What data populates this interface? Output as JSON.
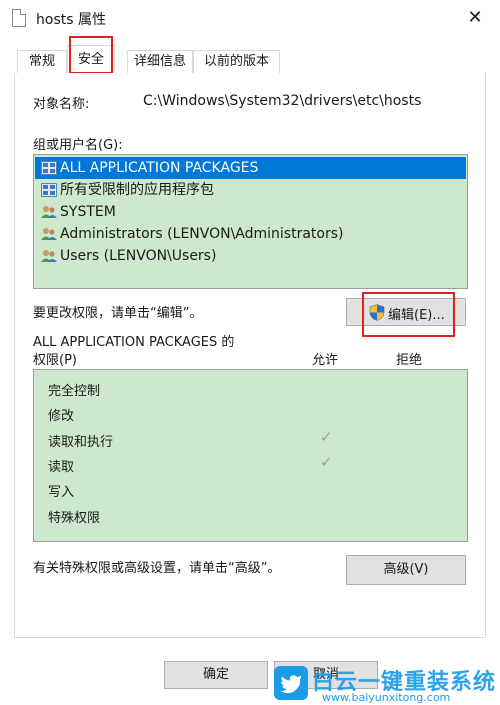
{
  "window": {
    "title": "hosts 属性",
    "close_glyph": "✕"
  },
  "tabs": [
    {
      "label": "常规"
    },
    {
      "label": "安全"
    },
    {
      "label": "详细信息"
    },
    {
      "label": "以前的版本"
    }
  ],
  "object_name": {
    "label": "对象名称:",
    "value": "C:\\Windows\\System32\\drivers\\etc\\hosts"
  },
  "groups": {
    "label": "组或用户名(G):",
    "items": [
      {
        "name": "ALL APPLICATION PACKAGES",
        "icon": "app-package-icon",
        "selected": true
      },
      {
        "name": "所有受限制的应用程序包",
        "icon": "app-package-icon",
        "selected": false
      },
      {
        "name": "SYSTEM",
        "icon": "user-group-icon",
        "selected": false
      },
      {
        "name": "Administrators (LENVON\\Administrators)",
        "icon": "user-group-icon",
        "selected": false
      },
      {
        "name": "Users (LENVON\\Users)",
        "icon": "user-group-icon",
        "selected": false
      }
    ]
  },
  "edit_hint": "要更改权限，请单击“编辑”。",
  "edit_button": {
    "label": "编辑(E)...",
    "icon": "uac-shield-icon"
  },
  "permissions": {
    "title_line1": "ALL APPLICATION PACKAGES 的",
    "title_line2": "权限(P)",
    "allow_header": "允许",
    "deny_header": "拒绝",
    "rows": [
      {
        "name": "完全控制",
        "allow": false,
        "deny": false
      },
      {
        "name": "修改",
        "allow": false,
        "deny": false
      },
      {
        "name": "读取和执行",
        "allow": true,
        "deny": false
      },
      {
        "name": "读取",
        "allow": true,
        "deny": false
      },
      {
        "name": "写入",
        "allow": false,
        "deny": false
      },
      {
        "name": "特殊权限",
        "allow": false,
        "deny": false
      }
    ],
    "check_glyph": "✓"
  },
  "advanced_hint": "有关特殊权限或高级设置，请单击“高级”。",
  "advanced_button": "高级(V)",
  "buttons": {
    "ok": "确定",
    "cancel": "取消"
  },
  "watermark": {
    "brand": "白云一键重装系统",
    "url": "www.baiyunxitong.com"
  },
  "colors": {
    "selection": "#0078d7",
    "list_bg": "#cde8cd",
    "highlight": "#e02020",
    "watermark_blue": "#1c9ce8"
  }
}
